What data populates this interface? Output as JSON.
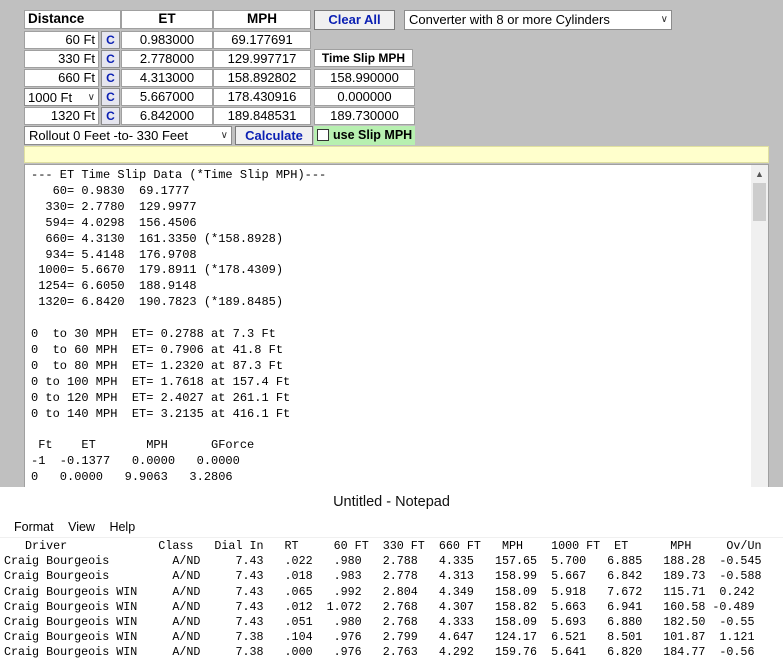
{
  "header": {
    "distance": "Distance",
    "et": "ET",
    "mph": "MPH"
  },
  "clear_all": "Clear All",
  "converter_select": "Converter  with  8  or  more Cylinders",
  "time_slip_mph_label": "Time Slip MPH",
  "c_label": "C",
  "rows": [
    {
      "distance": "60 Ft",
      "et": "0.983000",
      "mph": "69.177691",
      "slip": ""
    },
    {
      "distance": "330 Ft",
      "et": "2.778000",
      "mph": "129.997717",
      "slip": ""
    },
    {
      "distance": "660 Ft",
      "et": "4.313000",
      "mph": "158.892802",
      "slip": "158.990000"
    },
    {
      "distance": "1000 Ft",
      "et": "5.667000",
      "mph": "178.430916",
      "slip": "0.000000"
    },
    {
      "distance": "1320 Ft",
      "et": "6.842000",
      "mph": "189.848531",
      "slip": "189.730000"
    }
  ],
  "rollout_select": "Rollout 0 Feet -to- 330 Feet",
  "calculate": "Calculate",
  "use_slip_mph": "use Slip MPH",
  "output_text": "--- ET Time Slip Data (*Time Slip MPH)---\n   60= 0.9830  69.1777\n  330= 2.7780  129.9977\n  594= 4.0298  156.4506\n  660= 4.3130  161.3350 (*158.8928)\n  934= 5.4148  176.9708\n 1000= 5.6670  179.8911 (*178.4309)\n 1254= 6.6050  188.9148\n 1320= 6.8420  190.7823 (*189.8485)\n\n0  to 30 MPH  ET= 0.2788 at 7.3 Ft\n0  to 60 MPH  ET= 0.7906 at 41.8 Ft\n0  to 80 MPH  ET= 1.2320 at 87.3 Ft\n0 to 100 MPH  ET= 1.7618 at 157.4 Ft\n0 to 120 MPH  ET= 2.4027 at 261.1 Ft\n0 to 140 MPH  ET= 3.2135 at 416.1 Ft\n\n Ft    ET       MPH      GForce\n-1  -0.1377   0.0000   0.0000\n0   0.0000   9.9063   3.2806",
  "notepad": {
    "title": "Untitled - Notepad",
    "menu": [
      "Format",
      "View",
      "Help"
    ],
    "text": "   Driver             Class   Dial In   RT     60 FT  330 FT  660 FT   MPH    1000 FT  ET      MPH     Ov/Un\nCraig Bourgeois         A/ND     7.43   .022   .980   2.788   4.335   157.65  5.700   6.885   188.28  -0.545\nCraig Bourgeois         A/ND     7.43   .018   .983   2.778   4.313   158.99  5.667   6.842   189.73  -0.588\nCraig Bourgeois WIN     A/ND     7.43   .065   .992   2.804   4.349   158.09  5.918   7.672   115.71  0.242\nCraig Bourgeois WIN     A/ND     7.43   .012  1.072   2.768   4.307   158.82  5.663   6.941   160.58 -0.489\nCraig Bourgeois WIN     A/ND     7.43   .051   .980   2.768   4.333   158.09  5.693   6.880   182.50  -0.55\nCraig Bourgeois WIN     A/ND     7.38   .104   .976   2.799   4.647   124.17  6.521   8.501   101.87  1.121\nCraig Bourgeois WIN     A/ND     7.38   .000   .976   2.763   4.292   159.76  5.641   6.820   184.77  -0.56"
  }
}
